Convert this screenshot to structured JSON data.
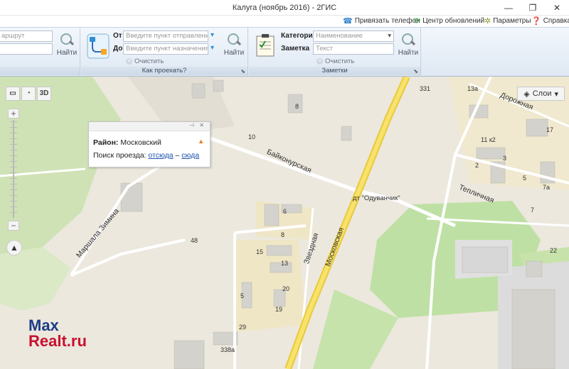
{
  "window": {
    "title": "Калуга (ноябрь 2016) - 2ГИС",
    "controls": [
      "—",
      "❐",
      "✕"
    ]
  },
  "menu": {
    "phone": "Привязать телефон",
    "updates": "Центр обновлений",
    "params": "Параметры",
    "help": "Справка"
  },
  "ribbon": {
    "search": {
      "route_placeholder": "аршрут",
      "find": "Найти"
    },
    "route": {
      "from_label": "От",
      "to_label": "До",
      "from_placeholder": "Введите пункт отправления",
      "to_placeholder": "Введите пункт назначения",
      "clear": "Очистить",
      "find": "Найти",
      "group_label": "Как проехать?"
    },
    "notes": {
      "category_label": "Категория",
      "note_label": "Заметка",
      "category_placeholder": "Наименование",
      "note_placeholder": "Текст",
      "clear": "Очистить",
      "find": "Найти",
      "group_label": "Заметки"
    }
  },
  "map": {
    "controls": {
      "mode_3d": "3D",
      "layers": "Слои"
    },
    "streets": {
      "baikonurskaya": "Байконурская",
      "zvezdnaya": "Звездная",
      "moskovskaya": "Московская",
      "marshala_zimina": "Маршала Зимина",
      "teplichnaya": "Тепличная",
      "dorozhnaya": "Дорожная"
    },
    "poi": {
      "odu": "дт \"Одуванчик\""
    },
    "house_numbers": {
      "n10": "10",
      "n8a": "8",
      "n6": "6",
      "n8b": "8",
      "n48": "48",
      "n15": "15",
      "n13": "13",
      "n5": "5",
      "n20": "20",
      "n19": "19",
      "n29": "29",
      "n338a": "338a",
      "n331": "331",
      "n13a": "13a",
      "n17": "17",
      "n11k2": "11 к2",
      "n3": "3",
      "n2": "2",
      "n5b": "5",
      "n7a": "7а",
      "n7": "7",
      "n22": "22"
    }
  },
  "popup": {
    "district_label": "Район:",
    "district_value": "Московский",
    "route_search": "Поиск проезда:",
    "from_here": "отсюда",
    "dash": "–",
    "to_here": "сюда"
  },
  "watermark": {
    "line1": "Max",
    "line2": "Realt.ru"
  }
}
